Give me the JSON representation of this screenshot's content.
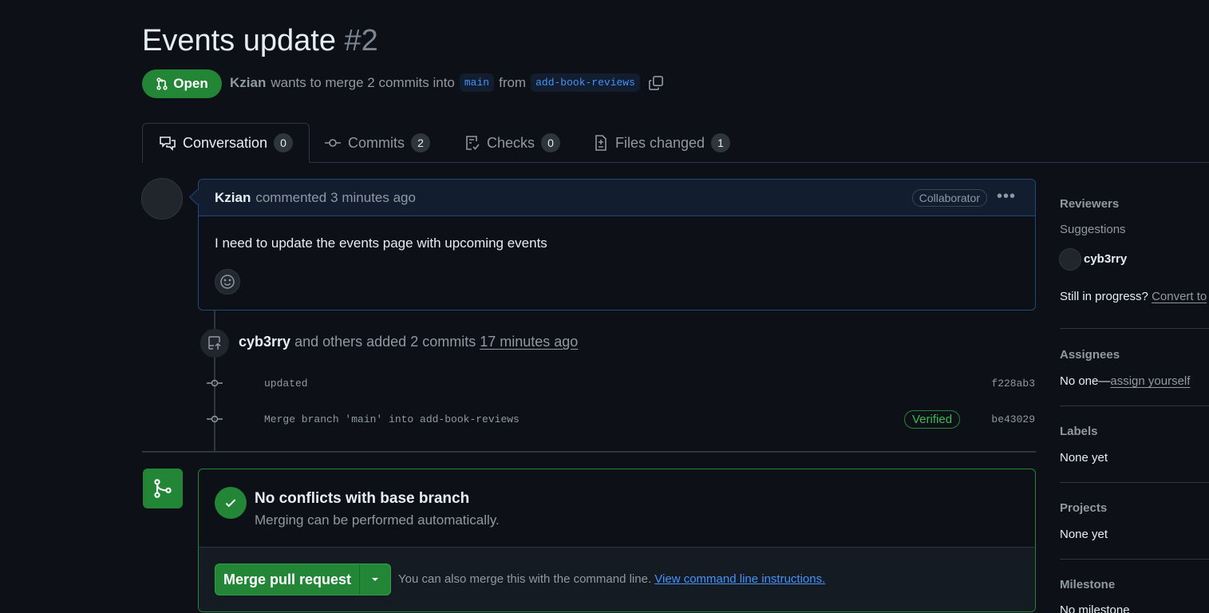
{
  "pr": {
    "title": "Events update",
    "number": "#2",
    "state": "Open",
    "author": "Kzian",
    "merge_text": "wants to merge 2 commits into",
    "base_branch": "main",
    "from_text": "from",
    "head_branch": "add-book-reviews"
  },
  "tabs": [
    {
      "label": "Conversation",
      "count": "0"
    },
    {
      "label": "Commits",
      "count": "2"
    },
    {
      "label": "Checks",
      "count": "0"
    },
    {
      "label": "Files changed",
      "count": "1"
    }
  ],
  "comment": {
    "author": "Kzian",
    "action": "commented",
    "time": "3 minutes ago",
    "role": "Collaborator",
    "body": "I need to update the events page with upcoming events"
  },
  "timeline": {
    "actor": "cyb3rry",
    "action": "and others added 2 commits",
    "time": "17 minutes ago",
    "commits": [
      {
        "message": "updated",
        "sha": "f228ab3",
        "verified": ""
      },
      {
        "message": "Merge branch 'main' into add-book-reviews",
        "sha": "be43029",
        "verified": "Verified"
      }
    ]
  },
  "merge": {
    "title": "No conflicts with base branch",
    "subtitle": "Merging can be performed automatically.",
    "button": "Merge pull request",
    "hint": "You can also merge this with the command line.",
    "hint_link": "View command line instructions."
  },
  "sidebar": {
    "reviewers_label": "Reviewers",
    "suggestions_label": "Suggestions",
    "suggested_reviewer": "cyb3rry",
    "in_progress": "Still in progress?",
    "convert_link": "Convert to",
    "assignees_label": "Assignees",
    "assignees_none": "No one—",
    "assign_yourself": "assign yourself",
    "labels_label": "Labels",
    "labels_value": "None yet",
    "projects_label": "Projects",
    "projects_value": "None yet",
    "milestone_label": "Milestone",
    "milestone_value": "No milestone"
  },
  "colors": {
    "background": "#0d1117",
    "open_green": "#238636",
    "link_blue": "#4493f8",
    "muted": "#9198a1"
  }
}
